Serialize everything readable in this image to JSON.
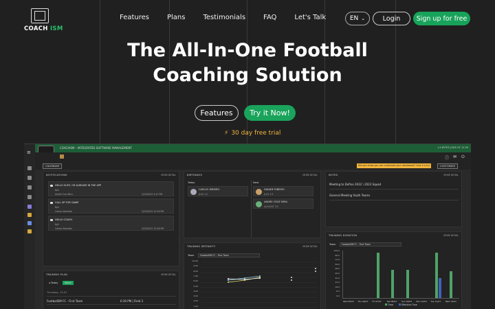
{
  "nav": {
    "logo_coach": "COACH",
    "logo_ism": "ISM",
    "links": [
      "Features",
      "Plans",
      "Testimonials",
      "FAQ",
      "Let's Talk"
    ],
    "lang": "EN",
    "login": "Login",
    "signup": "Sign up for free"
  },
  "hero": {
    "line1": "The All-In-One Football",
    "line2": "Coaching Solution",
    "features_btn": "Features",
    "try_btn": "Try it Now!",
    "trial": "30 day free trial"
  },
  "app": {
    "title": "COACHISM – INTEGRATED SOFTWARE MANAGEMENT",
    "version": "1.0 BYTE5 (OD5 OF 12.59",
    "calendar": "CALENDAR",
    "tip": "Did you know you can customize your dashboard? Give it a try!",
    "customize": "CUSTOMIZE",
    "more": "MORE DETAIL",
    "notifications": {
      "title": "NOTIFICATIONS",
      "items": [
        {
          "title": "HELLO GUYS, I'M ALREADY IN THE APP",
          "sub1": "N/A",
          "sub2": "André Cruz Mira",
          "date": "2/23/2022 5:47 PM"
        },
        {
          "title": "CALL UP FOR GAME",
          "sub1": "N/A",
          "sub2": "Carlos Valentim",
          "date": "2/23/2022 12:29 PM"
        },
        {
          "title": "HELLO COACH",
          "sub1": "N/A",
          "sub2": "Carlos Valentim",
          "date": "2/23/2022 12:26 PM"
        }
      ]
    },
    "birthdays": {
      "title": "BIRTHDAYS",
      "today": "Today",
      "next": "Next",
      "items": [
        {
          "name": "CARLOS RIBEIRO",
          "date": "JULY 12"
        },
        {
          "name": "DANIDE RIBEIRO",
          "date": "JULY 13"
        },
        {
          "name": "ANDRE CRUZ MIRA",
          "date": "AUGUST 25"
        }
      ]
    },
    "notes": {
      "title": "NOTES",
      "items": [
        "Meeting to Define 2022 \\ 2023 Squad",
        "General Meeting Youth Teams"
      ]
    },
    "intensity": {
      "title": "TRAINING INTENSITY",
      "team_label": "Team",
      "team": "FootballSM FC - First Team",
      "ticks": [
        "10.00",
        "9.00",
        "8.00",
        "7.00",
        "6.00",
        "5.00",
        "4.00",
        "3.00",
        "2.00",
        "1.00"
      ]
    },
    "plan": {
      "title": "TRAINING PLAN",
      "today": "Today",
      "week": "Week",
      "date": "Thursday, 13-07",
      "team": "FootballSM FC - First Team",
      "time": "6:30 PM | Field 3"
    },
    "duration": {
      "title": "TRAINING DURATION",
      "team_label": "Team",
      "team": "FootballSM FC - First Team",
      "ticks": [
        "144.0",
        "96.0",
        "72.0",
        "56.0",
        "48.0",
        "40.0",
        "32.0",
        "24.0",
        "16.0",
        "8.0",
        "0.0"
      ],
      "days": [
        "Wed 05/07",
        "Thu 06/07",
        "Fri 07/07",
        "Sat 08/07",
        "Sun 09/07",
        "Mon 10/07",
        "Tue 11/07",
        "Wed 12/07"
      ],
      "legend": [
        "Time",
        "Effective Time"
      ]
    }
  },
  "colors": {
    "accent": "#18a35a",
    "tip": "#f2b63d",
    "bar_green": "#4fa36a",
    "bar_blue": "#3d62b8"
  },
  "chart_data": {
    "type": "bar",
    "categories": [
      "Wed 05/07",
      "Thu 06/07",
      "Fri 07/07",
      "Sat 08/07",
      "Sun 09/07",
      "Mon 10/07",
      "Tue 11/07",
      "Wed 12/07"
    ],
    "series": [
      {
        "name": "Time",
        "values": [
          0,
          0,
          135,
          85,
          85,
          0,
          135,
          80
        ]
      },
      {
        "name": "Effective Time",
        "values": [
          0,
          0,
          0,
          0,
          0,
          0,
          60,
          0
        ]
      }
    ]
  }
}
